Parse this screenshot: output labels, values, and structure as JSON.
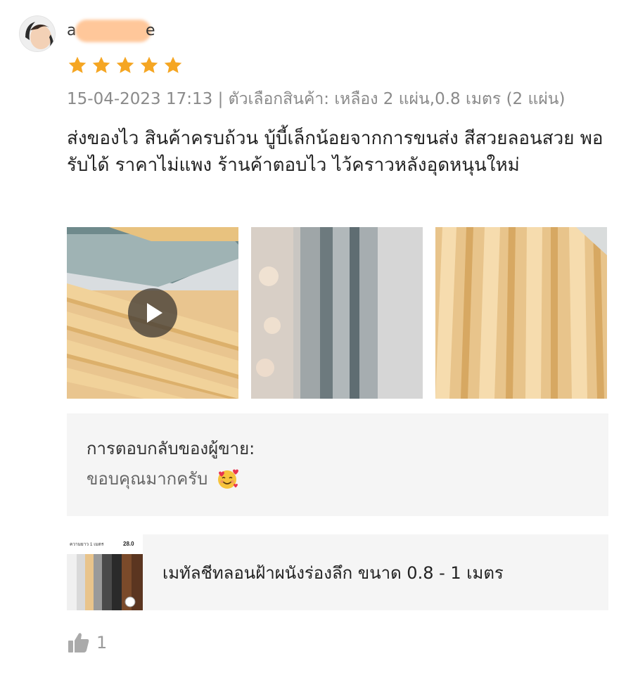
{
  "review": {
    "username_prefix": "a",
    "username_suffix": "e",
    "rating": 5,
    "date_time": "15-04-2023 17:13",
    "variation_label": "ตัวเลือกสินค้า:",
    "variation_value": "เหลือง 2 แผ่น,0.8 เมตร (2 แผ่น)",
    "text": "ส่งของไว สินค้าครบถ้วน บู้บี้เล็กน้อยจากการขนส่ง สีสวยลอนสวย พอรับได้ ราคาไม่แพง ร้านค้าตอบไว ไว้คราวหลังอุดหนุนใหม่",
    "media": [
      {
        "kind": "video",
        "icon": "play-icon"
      },
      {
        "kind": "image"
      },
      {
        "kind": "image"
      }
    ],
    "like_count": "1"
  },
  "seller_reply": {
    "title": "การตอบกลับของผู้ขาย:",
    "text": "ขอบคุณมากครับ",
    "emoji": "smiling-face-with-hearts"
  },
  "product": {
    "name": "เมทัลชีทลอนฝ้าผนังร่องลึก ขนาด 0.8 - 1 เมตร",
    "thumb_caption": "ความยาว 1 เมตร",
    "thumb_badge": "28.0"
  },
  "colors": {
    "star": "#f5a623",
    "meta_text": "#8a8a8a",
    "reply_bg": "#f5f5f5",
    "like_icon": "#aaaaaa"
  }
}
